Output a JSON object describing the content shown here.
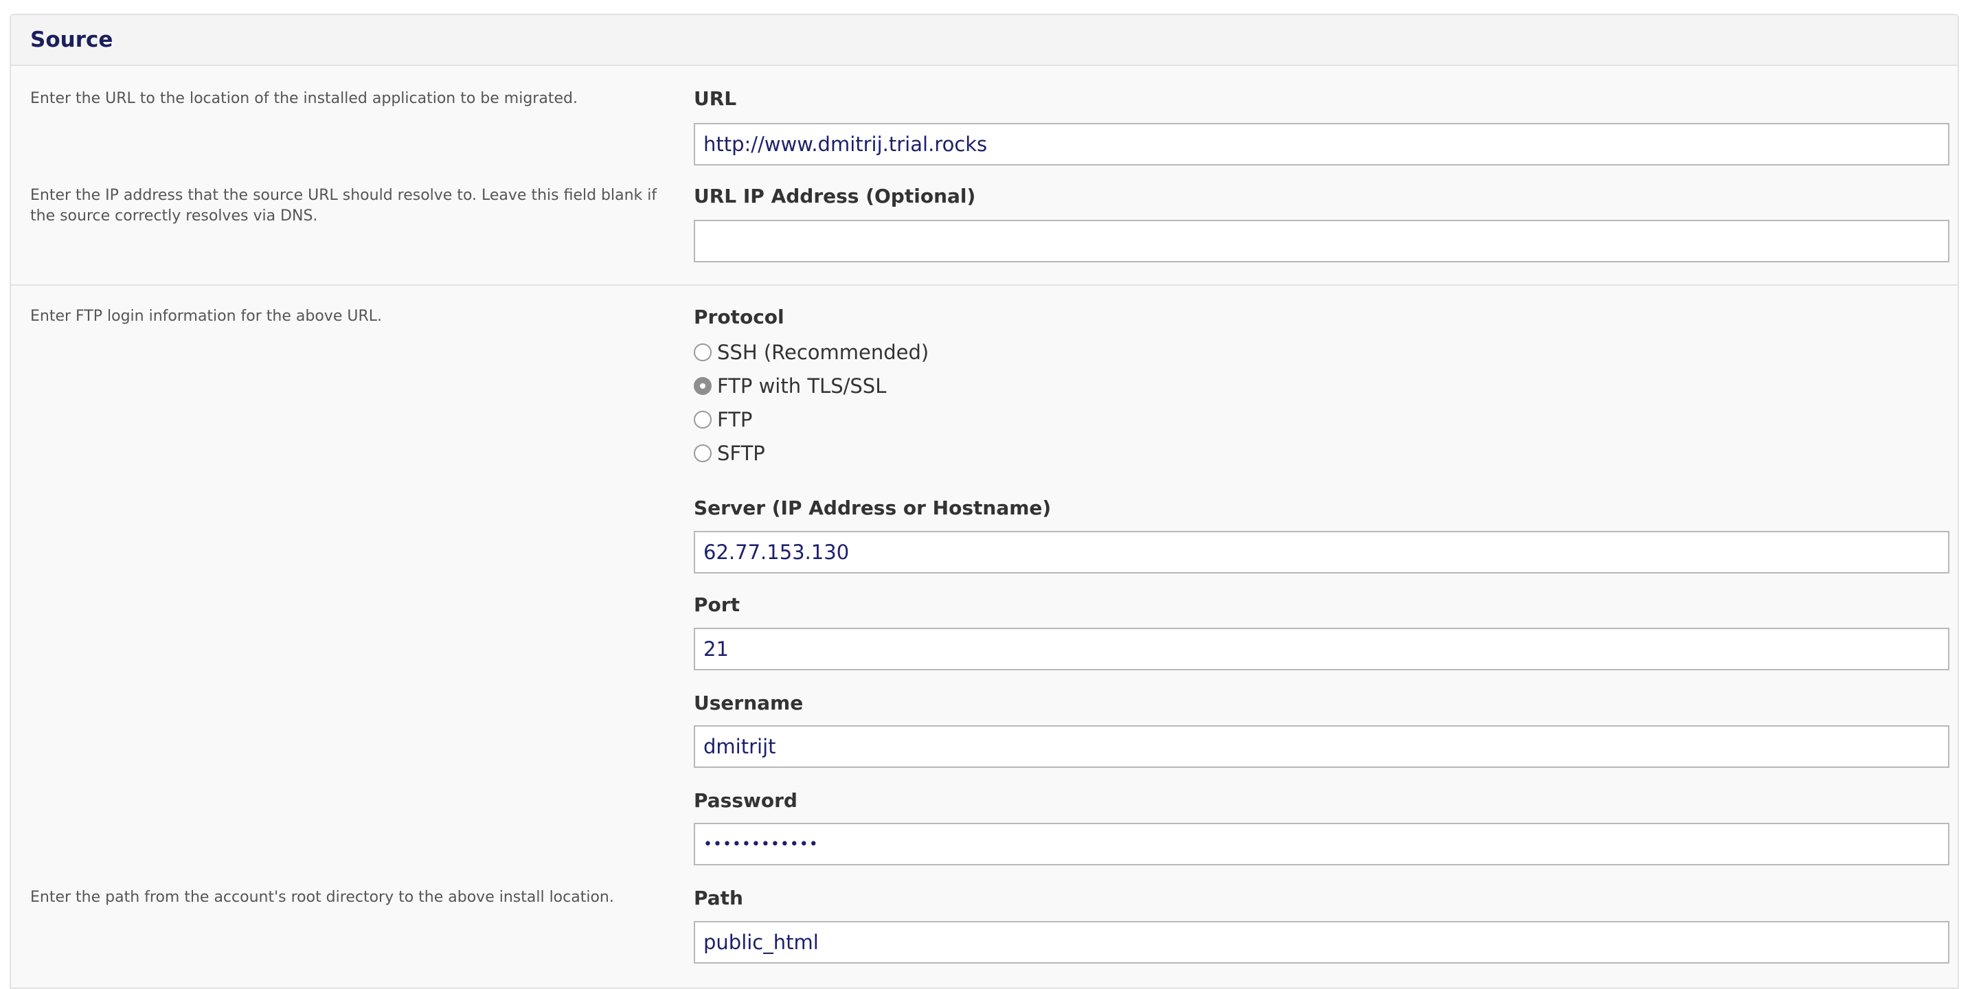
{
  "panel": {
    "title": "Source"
  },
  "url_section": {
    "help": "Enter the URL to the location of the installed application to be migrated.",
    "label": "URL",
    "value": "http://www.dmitrij.trial.rocks"
  },
  "ip_section": {
    "help": "Enter the IP address that the source URL should resolve to. Leave this field blank if the source correctly resolves via DNS.",
    "label": "URL IP Address (Optional)",
    "value": ""
  },
  "ftp_section": {
    "help": "Enter FTP login information for the above URL.",
    "protocol": {
      "label": "Protocol",
      "selected": "FTP with TLS/SSL",
      "options": [
        "SSH (Recommended)",
        "FTP with TLS/SSL",
        "FTP",
        "SFTP"
      ]
    },
    "server": {
      "label": "Server (IP Address or Hostname)",
      "value": "62.77.153.130"
    },
    "port": {
      "label": "Port",
      "value": "21"
    },
    "username": {
      "label": "Username",
      "value": "dmitrijt"
    },
    "password": {
      "label": "Password",
      "value": "••••••••••••"
    }
  },
  "path_section": {
    "help": "Enter the path from the account's root directory to the above install location.",
    "label": "Path",
    "value": "public_html"
  }
}
